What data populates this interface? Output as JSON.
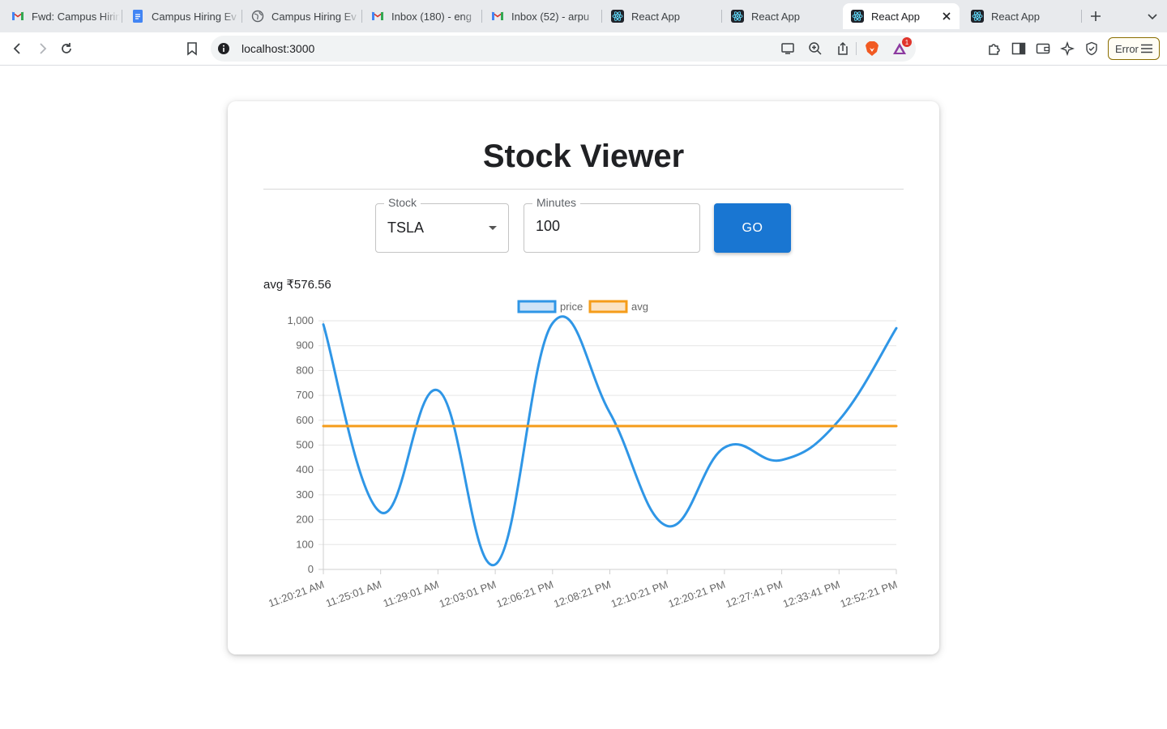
{
  "browser": {
    "tabs": [
      {
        "title": "Fwd: Campus Hiring",
        "icon": "gmail-icon"
      },
      {
        "title": "Campus Hiring Ev",
        "icon": "docs-icon"
      },
      {
        "title": "Campus Hiring Ev",
        "icon": "globe-icon"
      },
      {
        "title": "Inbox (180) - eng",
        "icon": "gmail-icon"
      },
      {
        "title": "Inbox (52) - arpu",
        "icon": "gmail-icon"
      },
      {
        "title": "React App",
        "icon": "react-icon"
      },
      {
        "title": "React App",
        "icon": "react-icon"
      },
      {
        "title": "React App",
        "icon": "react-icon",
        "active": true
      },
      {
        "title": "React App",
        "icon": "react-icon"
      }
    ],
    "url": "localhost:3000",
    "shields_count": "1",
    "error_label": "Error"
  },
  "page": {
    "title": "Stock Viewer",
    "stock_field": {
      "label": "Stock",
      "value": "TSLA"
    },
    "minutes_field": {
      "label": "Minutes",
      "value": "100"
    },
    "go_label": "GO",
    "avg_text": "avg ₹576.56"
  },
  "chart_data": {
    "type": "line",
    "legend": [
      "price",
      "avg"
    ],
    "x": [
      "11:20:21 AM",
      "11:25:01 AM",
      "11:29:01 AM",
      "12:03:01 PM",
      "12:06:21 PM",
      "12:08:21 PM",
      "12:10:21 PM",
      "12:20:21 PM",
      "12:27:41 PM",
      "12:33:41 PM",
      "12:52:21 PM"
    ],
    "series": [
      {
        "name": "price",
        "color": "#2f96e6",
        "values": [
          985,
          230,
          720,
          20,
          990,
          630,
          175,
          490,
          440,
          600,
          970
        ]
      },
      {
        "name": "avg",
        "color": "#f59c1a",
        "values": [
          576.56,
          576.56,
          576.56,
          576.56,
          576.56,
          576.56,
          576.56,
          576.56,
          576.56,
          576.56,
          576.56
        ]
      }
    ],
    "ylim": [
      0,
      1000
    ],
    "yticks": [
      "0",
      "100",
      "200",
      "300",
      "400",
      "500",
      "600",
      "700",
      "800",
      "900",
      "1,000"
    ],
    "grid": true,
    "legend_position": "top-center"
  }
}
